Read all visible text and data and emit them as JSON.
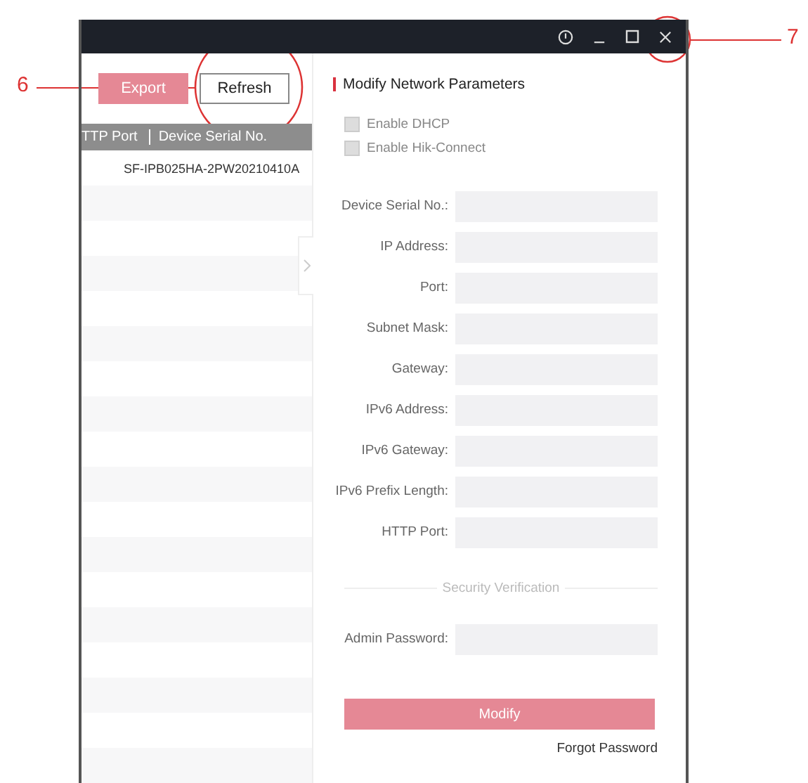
{
  "toolbar": {
    "buttons": [
      {
        "label": "Export",
        "disabled": true
      },
      {
        "label": "Refresh",
        "disabled": false
      }
    ]
  },
  "table": {
    "columns": [
      "TTP Port",
      "Device Serial No."
    ],
    "rows": [
      {
        "serial": "SF-IPB025HA-2PW20210410A"
      }
    ]
  },
  "panel": {
    "title": "Modify Network Parameters",
    "options": [
      {
        "label": "Enable DHCP",
        "checked": false
      },
      {
        "label": "Enable Hik-Connect",
        "checked": false
      }
    ],
    "fields": [
      {
        "label": "Device Serial No.:"
      },
      {
        "label": "IP Address:"
      },
      {
        "label": "Port:"
      },
      {
        "label": "Subnet Mask:"
      },
      {
        "label": "Gateway:"
      },
      {
        "label": "IPv6 Address:"
      },
      {
        "label": "IPv6 Gateway:"
      },
      {
        "label": "IPv6 Prefix Length:"
      },
      {
        "label": "HTTP Port:"
      }
    ],
    "security_heading": "Security Verification",
    "password": {
      "label": "Admin Password:"
    },
    "submit": {
      "label": "Modify",
      "disabled": true
    },
    "link": "Forgot Password"
  },
  "callouts": [
    {
      "number": "6"
    },
    {
      "number": "7"
    }
  ]
}
